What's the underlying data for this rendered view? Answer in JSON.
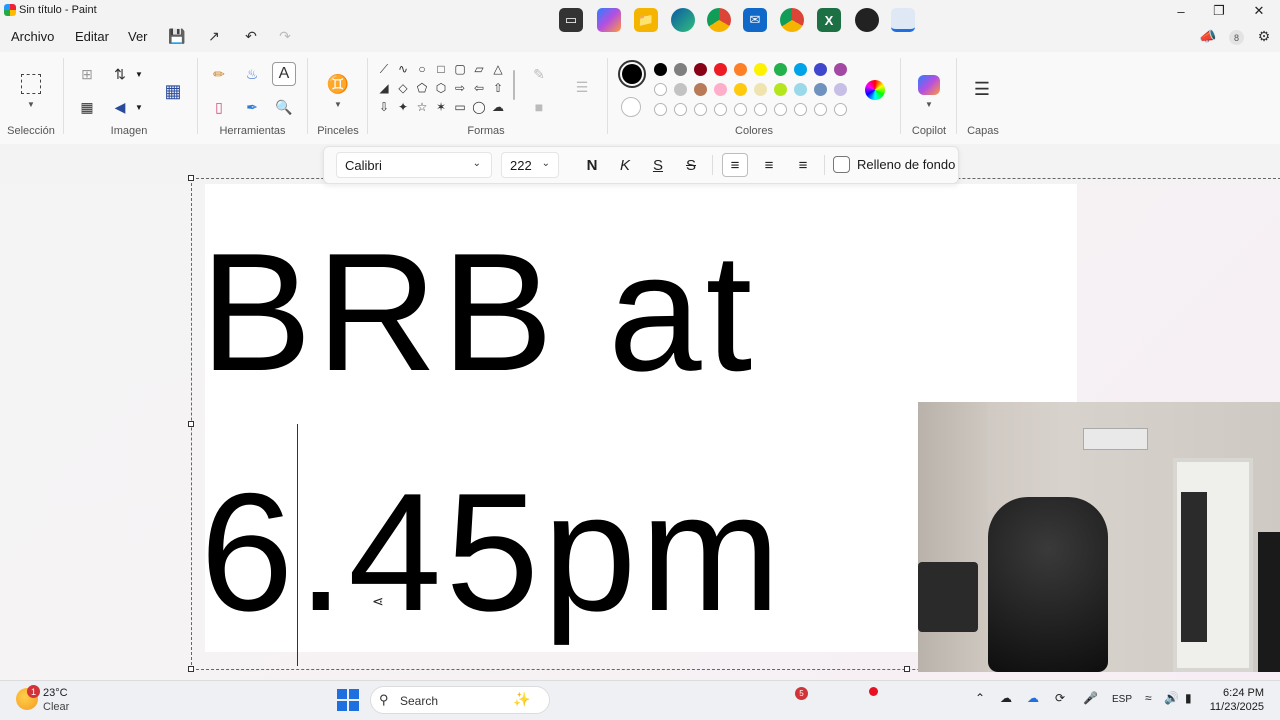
{
  "window": {
    "title": "Sin título - Paint"
  },
  "menu": {
    "items": [
      "Archivo",
      "Editar",
      "Ver"
    ]
  },
  "header": {
    "badge": "8"
  },
  "ribbon": {
    "groups": {
      "seleccion": "Selección",
      "imagen": "Imagen",
      "herramientas": "Herramientas",
      "pinceles": "Pinceles",
      "formas": "Formas",
      "colores": "Colores",
      "copilot": "Copilot",
      "capas": "Capas"
    },
    "primary_color": "#000000",
    "secondary_color": "#ffffff",
    "palette_row1": [
      "#000000",
      "#7f7f7f",
      "#880015",
      "#ed1c24",
      "#ff7f27",
      "#fff200",
      "#22b14c",
      "#00a2e8",
      "#3f48cc",
      "#a349a4"
    ],
    "palette_row2": [
      "#ffffff",
      "#c3c3c3",
      "#b97a57",
      "#ffaec9",
      "#ffc90e",
      "#efe4b0",
      "#b5e61d",
      "#99d9ea",
      "#7092be",
      "#c8bfe7"
    ]
  },
  "textbar": {
    "font": "Calibri",
    "size": "222",
    "bold": "N",
    "italic": "K",
    "underline": "S",
    "strike": "S",
    "fill_label": "Relleno de fondo"
  },
  "canvas": {
    "line1": "BRB at",
    "line2": "6.45pm"
  },
  "taskbar": {
    "weather_temp": "23°C",
    "weather_desc": "Clear",
    "weather_badge": "1",
    "search": "Search",
    "lang": "ESP",
    "time": "6:24 PM",
    "date": "11/23/2025",
    "chrome_badge": "5"
  }
}
